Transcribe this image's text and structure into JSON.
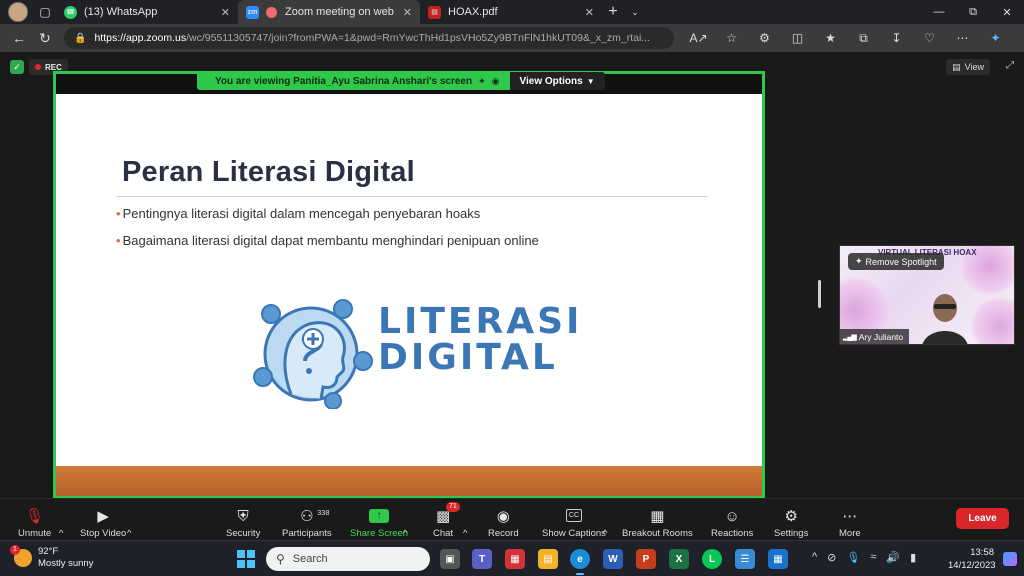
{
  "browser": {
    "tabs": [
      {
        "label": "(13) WhatsApp",
        "icon": "whatsapp-icon",
        "color": "#25d366"
      },
      {
        "label": "Zoom meeting on web",
        "icon": "zoom-icon",
        "color": "#2d8cff"
      },
      {
        "label": "HOAX.pdf",
        "icon": "pdf-icon",
        "color": "#c5221f"
      }
    ],
    "url_host": "https://app.zoom.us",
    "url_path": "/wc/95511305747/join?fromPWA=1&pwd=RmYwcThHd1psVHo5Zy9BTnFlN1hkUT09&_x_zm_rtai..."
  },
  "meeting": {
    "rec_label": "REC",
    "view_label": "View",
    "share_banner": "You are viewing  Panitia_Ayu Sabrina Anshari's screen",
    "view_options": "View Options",
    "slide": {
      "title": "Peran Literasi Digital",
      "bullets": [
        "Pentingnya literasi digital dalam mencegah penyebaran hoaks",
        "Bagaimana literasi digital dapat membantu menghindari penipuan online"
      ],
      "logo_line1": "LITERASI",
      "logo_line2": "DIGITAL"
    },
    "video_tile": {
      "spotlight_label": "Remove Spotlight",
      "name": "Ary Julianto",
      "bg_title": "VIRTUAL LITERASI HOAX"
    }
  },
  "toolbar": {
    "unmute": "Unmute",
    "stop_video": "Stop Video",
    "security": "Security",
    "participants": "Participants",
    "participants_count": "338",
    "share_screen": "Share Screen",
    "chat": "Chat",
    "chat_badge": "71",
    "record": "Record",
    "show_captions": "Show Captions",
    "cc": "CC",
    "breakout_rooms": "Breakout Rooms",
    "reactions": "Reactions",
    "settings": "Settings",
    "more": "More",
    "leave": "Leave",
    "accent": "#2fc84a",
    "leave_color": "#d9262b"
  },
  "taskbar": {
    "weather_temp": "92°F",
    "weather_desc": "Mostly sunny",
    "weather_badge": "1",
    "search_placeholder": "Search",
    "time": "13:58",
    "date": "14/12/2023"
  }
}
